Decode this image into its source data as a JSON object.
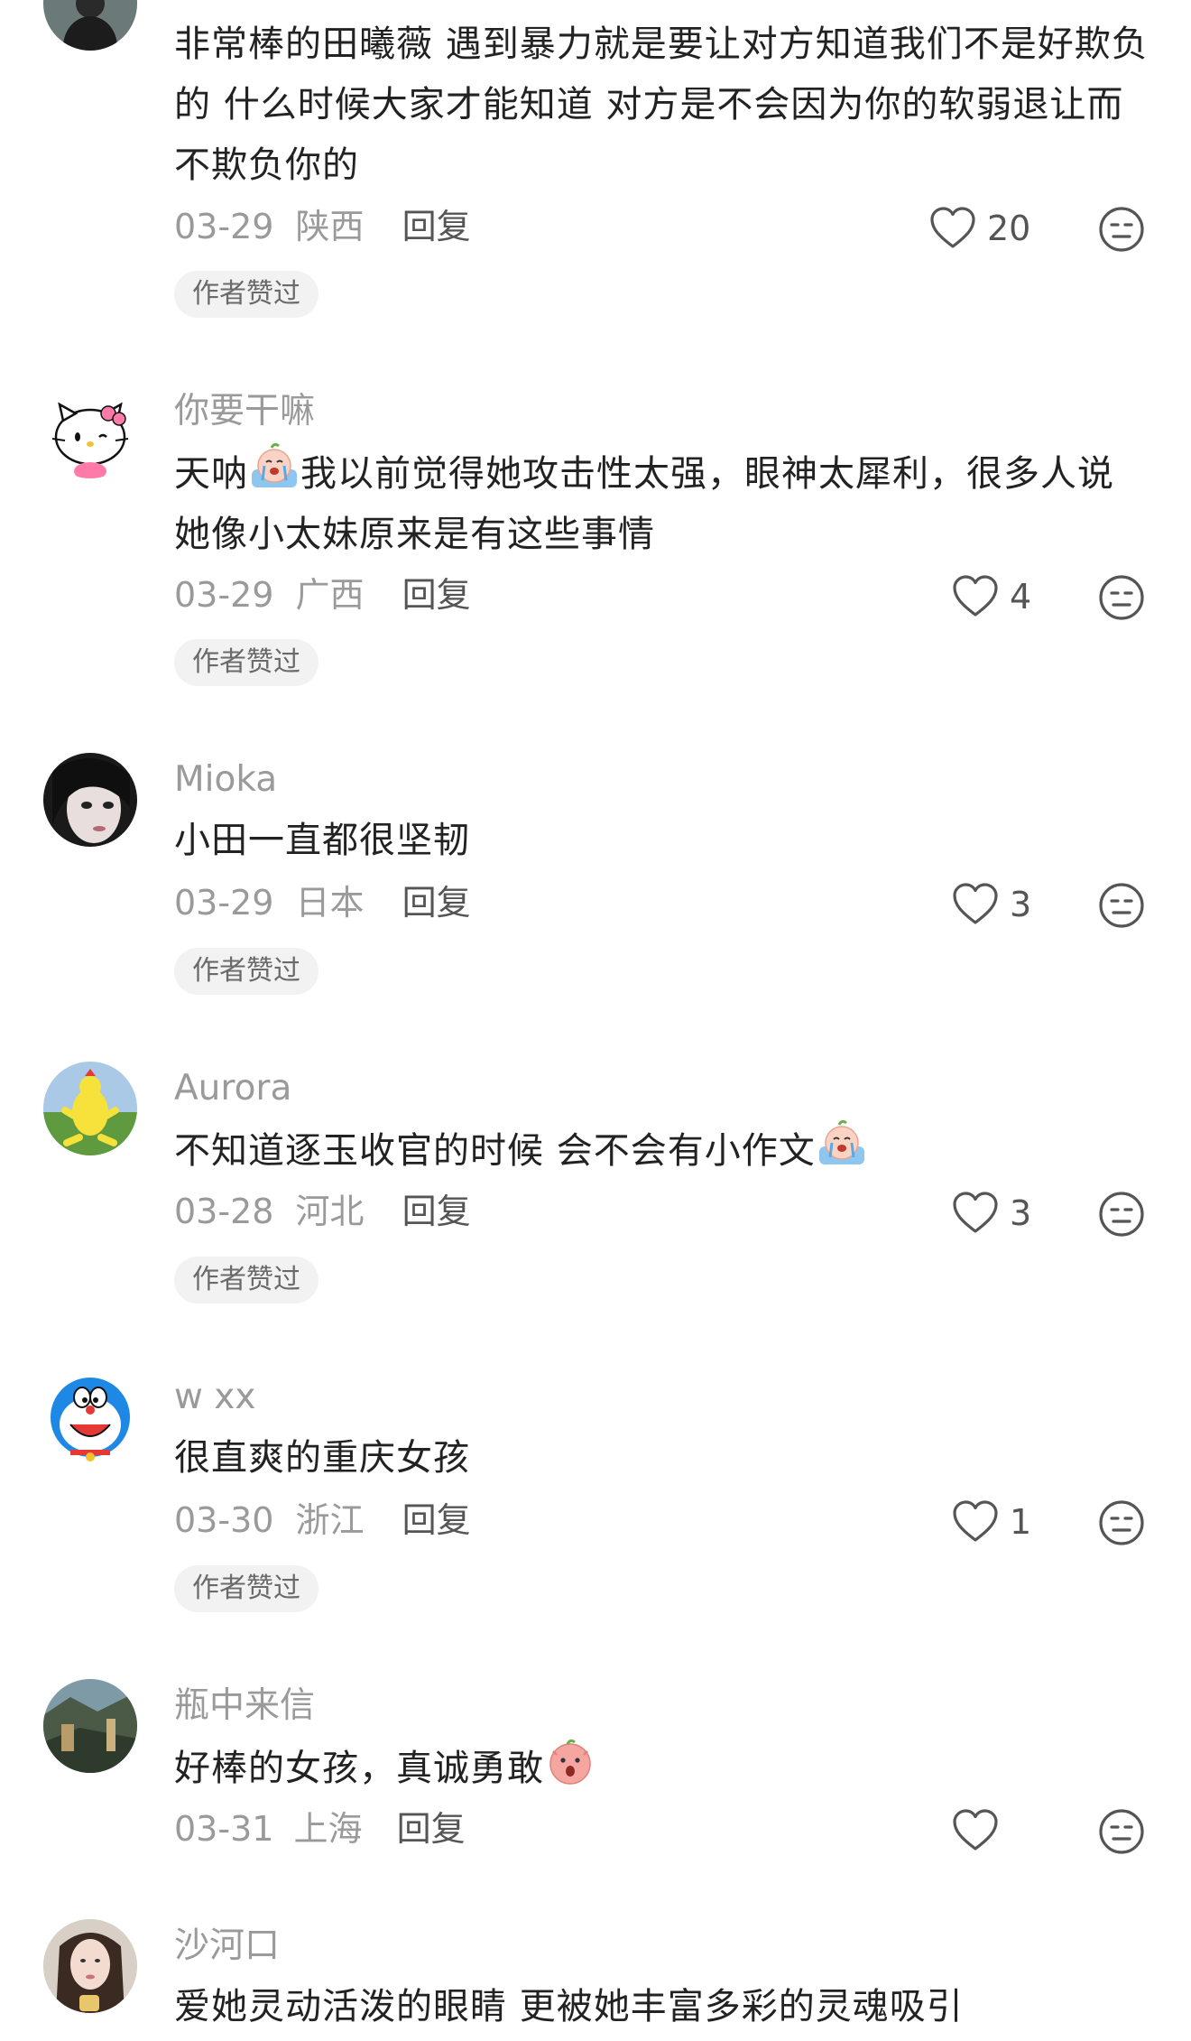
{
  "comments": [
    {
      "username": "",
      "text": "非常棒的田曦薇  遇到暴力就是要让对方知道我们不是好欺负的   什么时候大家才能知道  对方是不会因为你的软弱退让而不欺负你的",
      "date": "03-29",
      "location": "陕西",
      "reply": "回复",
      "likes": "20",
      "badge": "作者赞过",
      "avatar": "person-avatar"
    },
    {
      "username": "你要干嘛",
      "text_a": "天呐",
      "text_b": "我以前觉得她攻击性太强，眼神太犀利，很多人说她像小太妹原来是有这些事情",
      "emoji": "crying-face-emoji",
      "date": "03-29",
      "location": "广西",
      "reply": "回复",
      "likes": "4",
      "badge": "作者赞过",
      "avatar": "hello-kitty-avatar"
    },
    {
      "username": "Mioka",
      "text": "小田一直都很坚韧",
      "date": "03-29",
      "location": "日本",
      "reply": "回复",
      "likes": "3",
      "badge": "作者赞过",
      "avatar": "girl-portrait-avatar"
    },
    {
      "username": "Aurora",
      "text_a": "不知道逐玉收官的时候 会不会有小作文",
      "emoji": "crying-face-emoji",
      "date": "03-28",
      "location": "河北",
      "reply": "回复",
      "likes": "3",
      "badge": "作者赞过",
      "avatar": "yellow-chicken-avatar"
    },
    {
      "username": "w xx",
      "text": "很直爽的重庆女孩",
      "date": "03-30",
      "location": "浙江",
      "reply": "回复",
      "likes": "1",
      "badge": "作者赞过",
      "avatar": "doraemon-avatar"
    },
    {
      "username": "瓶中来信",
      "text_a": "好棒的女孩，真诚勇敢",
      "emoji": "shocked-face-emoji",
      "date": "03-31",
      "location": "上海",
      "reply": "回复",
      "likes": "",
      "avatar": "landscape-painting-avatar"
    },
    {
      "username": "沙河口",
      "text": "爱她灵动活泼的眼睛 更被她丰富多彩的灵魂吸引",
      "avatar": "woman-portrait-avatar"
    }
  ],
  "colors": {
    "text": "#222222",
    "muted": "#9a9a9a",
    "badge_bg": "#f2f2f2",
    "icon": "#555555"
  }
}
